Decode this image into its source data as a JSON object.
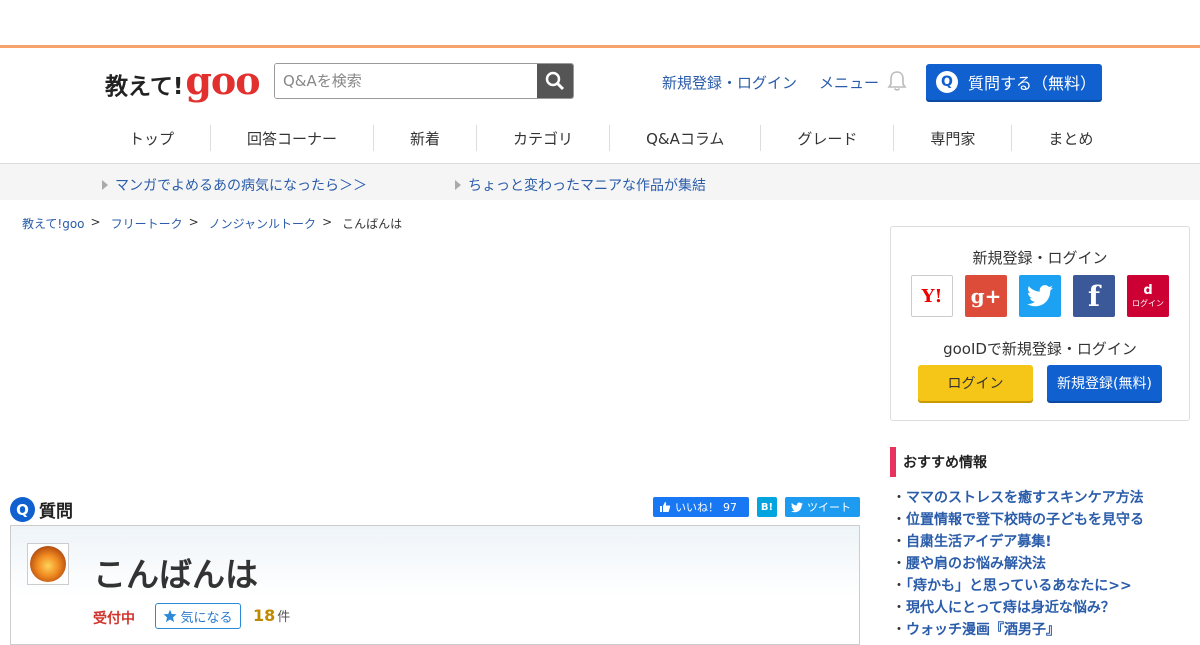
{
  "header": {
    "logo_text": "教えて!",
    "logo_brand": "goo",
    "search_placeholder": "Q&Aを検索",
    "register_login": "新規登録・ログイン",
    "menu": "メニュー",
    "ask_button": "質問する（無料）",
    "ask_icon": "Q"
  },
  "nav": [
    {
      "label": "トップ"
    },
    {
      "label": "回答コーナー"
    },
    {
      "label": "新着"
    },
    {
      "label": "カテゴリ"
    },
    {
      "label": "Q&Aコラム"
    },
    {
      "label": "グレード"
    },
    {
      "label": "専門家"
    },
    {
      "label": "まとめ"
    }
  ],
  "promo": [
    {
      "label": "マンガでよめるあの病気になったら＞＞"
    },
    {
      "label": "ちょっと変わったマニアな作品が集結"
    }
  ],
  "breadcrumb": [
    {
      "label": "教えて!goo",
      "sep": ">"
    },
    {
      "label": "フリートーク",
      "sep": ">"
    },
    {
      "label": "ノンジャンルトーク",
      "sep": ">"
    },
    {
      "label": "こんばんは"
    }
  ],
  "question": {
    "section_icon": "Q",
    "section_label": "質問",
    "like_label": "いいね！",
    "like_count": "97",
    "hatena": "B!",
    "tweet": "ツイート",
    "title": "こんばんは",
    "status": "受付中",
    "watch_label": "気になる",
    "count": "18",
    "count_unit": "件"
  },
  "login_box": {
    "title": "新規登録・ログイン",
    "sns_yahoo": "Y!",
    "sns_google": "g+",
    "sns_facebook": "f",
    "sns_docomo_mark": "d",
    "sns_docomo": "ログイン",
    "gooid": "gooIDで新規登録・ログイン",
    "login": "ログイン",
    "register": "新規登録(無料)"
  },
  "recommend": {
    "title": "おすすめ情報",
    "items": [
      "ママのストレスを癒すスキンケア方法",
      "位置情報で登下校時の子どもを見守る",
      "自粛生活アイデア募集!",
      "腰や肩のお悩み解決法",
      "「痔かも」と思っているあなたに>>",
      "現代人にとって痔は身近な悩み？",
      "ウォッチ漫画『酒男子』"
    ]
  },
  "colors": {
    "accent_blue": "#1060d0",
    "brand_red": "#e2302e",
    "top_border": "#f5a36b",
    "recommend_bar": "#e8335e"
  }
}
